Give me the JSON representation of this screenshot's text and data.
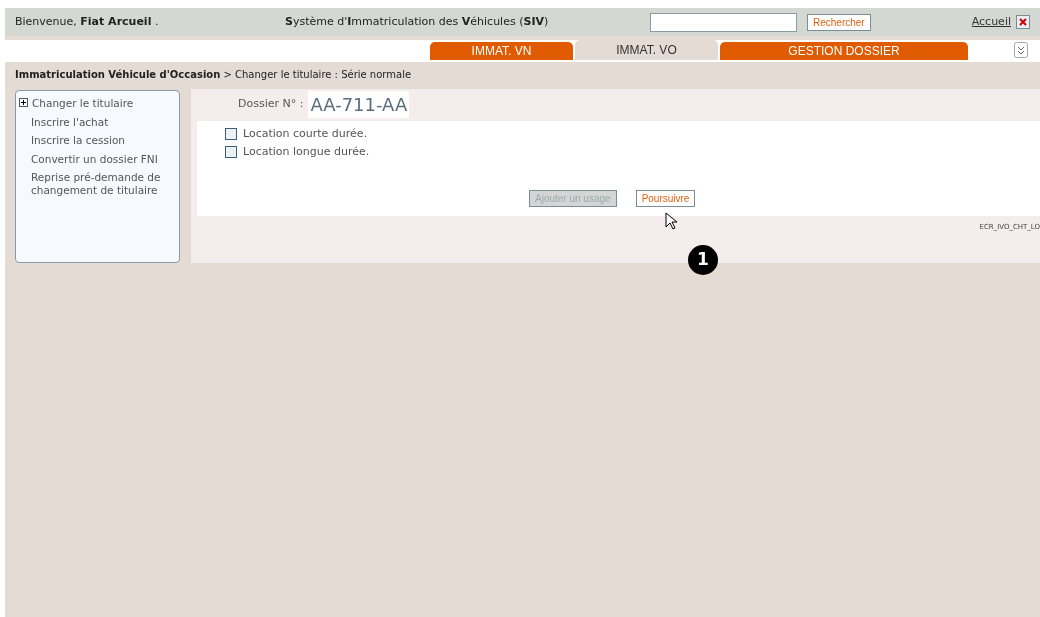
{
  "header": {
    "welcome": "Bienvenue, **Fiat Arcueil** .",
    "title": "**S**ystème d'**I**mmatriculation des **V**éhicules (**SIV**)",
    "search_button": "Rechercher",
    "home_link": "Accueil"
  },
  "tabs": [
    {
      "label": "IMMAT. VN",
      "selected": false
    },
    {
      "label": "IMMAT. VO",
      "selected": true
    },
    {
      "label": "GESTION DOSSIER",
      "selected": false
    }
  ],
  "breadcrumb": "**Immatriculation Véhicule d'Occasion** >  Changer le titulaire : Série normale",
  "sidebar": {
    "items": [
      {
        "label": "Changer le titulaire",
        "expandable": true
      },
      {
        "label": "Inscrire l'achat",
        "expandable": false
      },
      {
        "label": "Inscrire la cession",
        "expandable": false
      },
      {
        "label": "Convertir un dossier FNI",
        "expandable": false
      },
      {
        "label": "Reprise pré-demande de changement de titulaire",
        "expandable": false
      }
    ]
  },
  "dossier": {
    "label": "Dossier N° :",
    "number": "AA-711-AA"
  },
  "options": [
    {
      "label": "Location courte durée.",
      "checked": false
    },
    {
      "label": "Location longue durée.",
      "checked": false
    }
  ],
  "buttons": [
    {
      "label": "Ajouter un usage",
      "disabled": true
    },
    {
      "label": "Poursuivre",
      "disabled": false
    }
  ],
  "screen_code": "ECR_IVO_CHT_LO",
  "callout": "1"
}
